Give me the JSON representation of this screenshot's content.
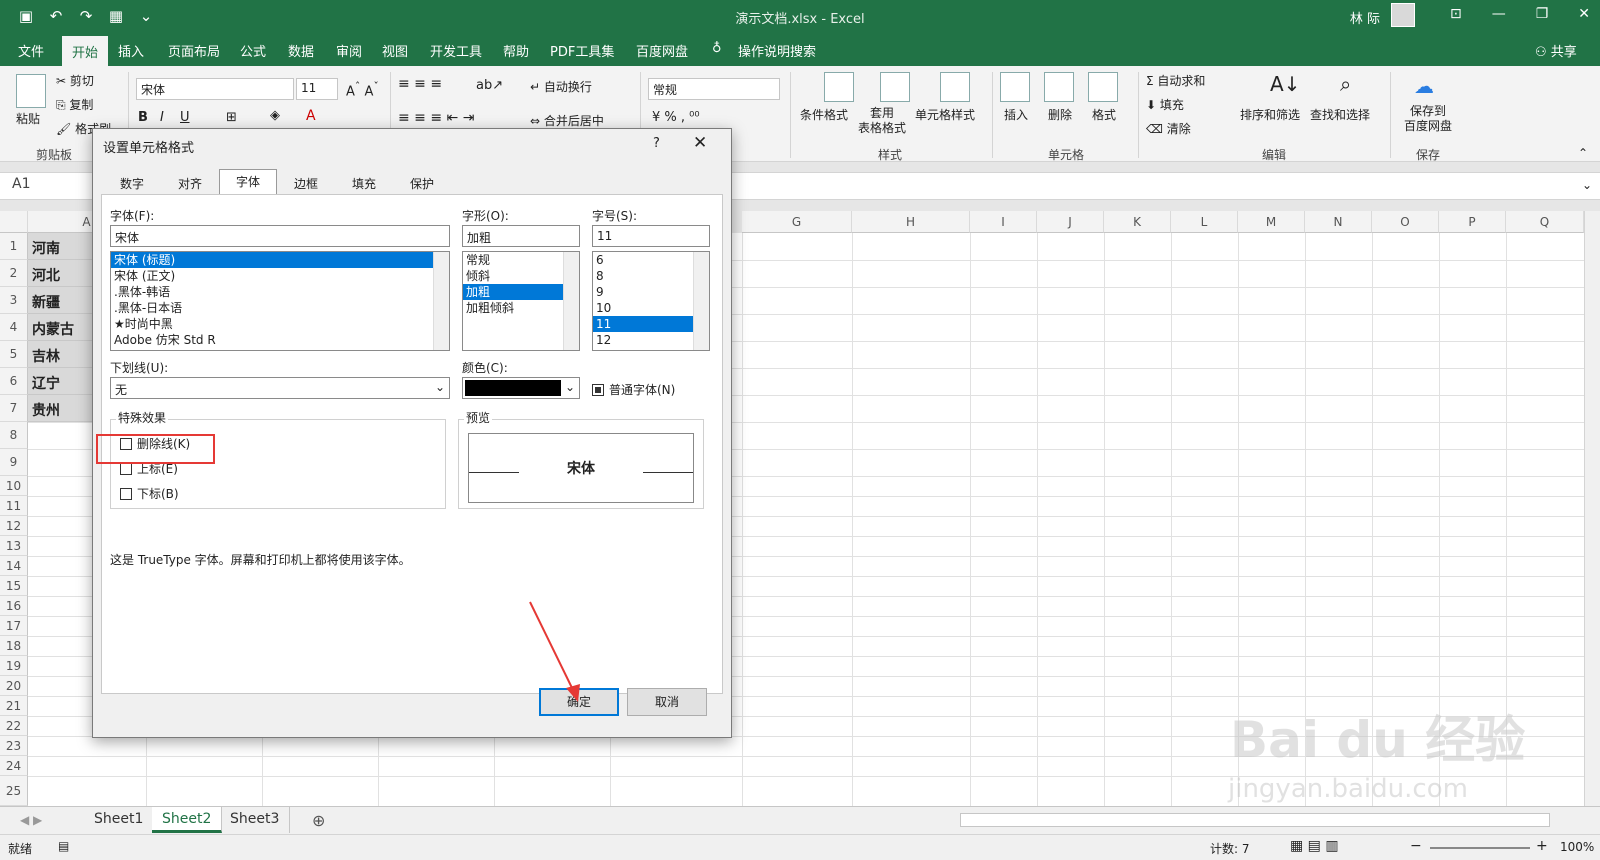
{
  "window": {
    "title": "演示文档.xlsx - Excel",
    "user": "林 际"
  },
  "menu": [
    "文件",
    "开始",
    "插入",
    "页面布局",
    "公式",
    "数据",
    "审阅",
    "视图",
    "开发工具",
    "帮助",
    "PDF工具集",
    "百度网盘",
    "操作说明搜索"
  ],
  "menu_active": "开始",
  "share_label": "共享",
  "ribbon": {
    "clipboard": {
      "paste": "粘贴",
      "cut": "剪切",
      "copy": "复制",
      "format_painter": "格式刷",
      "group": "剪贴板"
    },
    "font": {
      "name": "宋体",
      "size": "11"
    },
    "align": {
      "wrap": "自动换行",
      "merge": "合并后居中"
    },
    "number": {
      "format": "常规"
    },
    "styles": {
      "cond": "条件格式",
      "table": "套用\n表格格式",
      "cell": "单元格样式",
      "group": "样式"
    },
    "cells": {
      "insert": "插入",
      "delete": "删除",
      "format": "格式",
      "group": "单元格"
    },
    "edit": {
      "autosum": "自动求和",
      "fill": "填充",
      "clear": "清除",
      "sort": "排序和筛选",
      "find": "查找和选择",
      "group": "编辑"
    },
    "save": {
      "label": "保存到\n百度网盘",
      "group": "保存"
    }
  },
  "namebox": "A1",
  "columns": [
    "A",
    "G",
    "H",
    "I",
    "J",
    "K",
    "L",
    "M",
    "N",
    "O",
    "P",
    "Q"
  ],
  "rows": [
    "1",
    "2",
    "3",
    "4",
    "5",
    "6",
    "7",
    "8",
    "9",
    "10",
    "11",
    "12",
    "13",
    "14",
    "15",
    "16",
    "17",
    "18",
    "19",
    "20",
    "21",
    "22",
    "23",
    "24",
    "25"
  ],
  "cells_a": [
    "河南",
    "河北",
    "新疆",
    "内蒙古",
    "吉林",
    "辽宁",
    "贵州"
  ],
  "sheets": [
    "Sheet1",
    "Sheet2",
    "Sheet3"
  ],
  "active_sheet": "Sheet2",
  "status": {
    "ready": "就绪",
    "count": "计数: 7",
    "zoom": "100%"
  },
  "dialog": {
    "title": "设置单元格格式",
    "help": "?",
    "tabs": [
      "数字",
      "对齐",
      "字体",
      "边框",
      "填充",
      "保护"
    ],
    "active_tab": "字体",
    "font_label": "字体(F):",
    "font_value": "宋体",
    "font_list": [
      "宋体 (标题)",
      "宋体 (正文)",
      ".黑体-韩语",
      ".黑体-日本语",
      "★时尚中黑",
      "Adobe 仿宋 Std R"
    ],
    "style_label": "字形(O):",
    "style_value": "加粗",
    "style_list": [
      "常规",
      "倾斜",
      "加粗",
      "加粗倾斜"
    ],
    "size_label": "字号(S):",
    "size_value": "11",
    "size_list": [
      "6",
      "8",
      "9",
      "10",
      "11",
      "12"
    ],
    "underline_label": "下划线(U):",
    "underline_value": "无",
    "color_label": "颜色(C):",
    "normal_font": "普通字体(N)",
    "effects_label": "特殊效果",
    "strike": "删除线(K)",
    "superscript": "上标(E)",
    "subscript": "下标(B)",
    "preview_label": "预览",
    "preview_text": "宋体",
    "note": "这是 TrueType 字体。屏幕和打印机上都将使用该字体。",
    "ok": "确定",
    "cancel": "取消"
  },
  "watermark": {
    "brand": "Bai du 经验",
    "url": "jingyan.baidu.com"
  }
}
